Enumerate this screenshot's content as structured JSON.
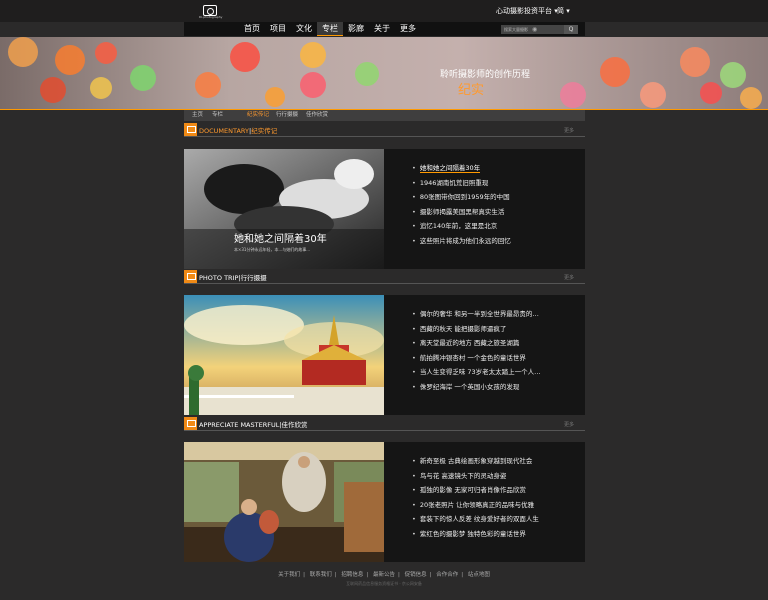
{
  "header": {
    "logo_sub": "Di-photography",
    "platform": "心动摄影投资平台 ▾",
    "lang": "简 ▾"
  },
  "nav": {
    "items": [
      "首页",
      "项目",
      "文化",
      "专栏",
      "影廊",
      "关于",
      "更多"
    ],
    "active_index": 3,
    "search_placeholder": "搜索大量摄影",
    "search_button": "Q"
  },
  "banner": {
    "subtitle": "聆听摄影师的创作历程",
    "title": "纪实"
  },
  "breadcrumb": [
    "主页",
    "专栏",
    "纪实传记",
    "行行摄摄",
    "佳作欣赏"
  ],
  "sections": [
    {
      "en": "DOCUMENTARY",
      "cn": "纪实传记",
      "more": "更多",
      "img_caption_title": "她和她之间隔着30年",
      "img_caption_sub": "本×31分钟永远年轻，本...与她们的故事...",
      "items": [
        "她和她之间隔着30年",
        "1946湖南饥荒旧照重现",
        "80张图带你回到1959年的中国",
        "摄影师揭露美国黑帮真实生活",
        "追忆140年前，这里是北京",
        "这些照片将成为他们永远的回忆"
      ]
    },
    {
      "en": "PHOTO TRIP",
      "cn": "行行摄摄",
      "more": "更多",
      "items": [
        "偶尔的奢华 和另一半到全世界最昂贵的…",
        "西藏的秋天 能把摄影师逼疯了",
        "离天堂最近的地方 西藏之旅圣湖篇",
        "航拍腾冲银杏村 一个金色的童话世界",
        "当人生变得乏味 73岁老太太踏上一个人…",
        "侏罗纪海岸 一个英国小女孩的发现"
      ]
    },
    {
      "en": "APPRECIATE MASTERFUL",
      "cn": "佳作欣赏",
      "more": "更多",
      "items": [
        "新奇至极 古典绘画形象穿越到现代社会",
        "鸟与花 高速镜头下的灵动身姿",
        "孤独的影像 无家可归者肖像作品欣赏",
        "20张老照片 让你领略真正的品味与优雅",
        "套装下的惊人反差 纹身爱好者的双面人生",
        "紫红色的摄影梦 独特色彩的童话世界"
      ]
    }
  ],
  "footer": {
    "links": [
      "关于我们",
      "联系我们",
      "招聘信息",
      "最新公告",
      "促销信息",
      "合作合作",
      "站点地图"
    ],
    "copyright": "互联网药品信息服务资格证书 · 京公网安备"
  }
}
